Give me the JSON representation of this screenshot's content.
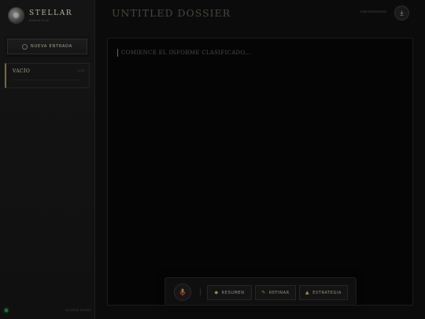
{
  "brand": {
    "name": "STELLAR",
    "subtitle": "EXECUTIVE"
  },
  "sidebar": {
    "new_entry_label": "NUEVA ENTRADA",
    "entries": [
      {
        "title": "VACÍO",
        "meta": "00:0"
      }
    ],
    "status_text": "SYSTEM READY"
  },
  "header": {
    "title": "UNTITLED DOSSIER",
    "sync_text": "SINCRONIZADO"
  },
  "editor": {
    "placeholder": "COMIENCE EL INFORME CLASIFICADO..."
  },
  "toolbar": {
    "actions": [
      {
        "label": "RESUMEN",
        "icon": "diamond-icon"
      },
      {
        "label": "REFINAR",
        "icon": "pen-icon"
      },
      {
        "label": "ESTRATEGIA",
        "icon": "triangle-icon"
      }
    ]
  },
  "colors": {
    "accent": "#a38a4a",
    "background": "#0b0b0b",
    "status_online": "#2ea050"
  }
}
